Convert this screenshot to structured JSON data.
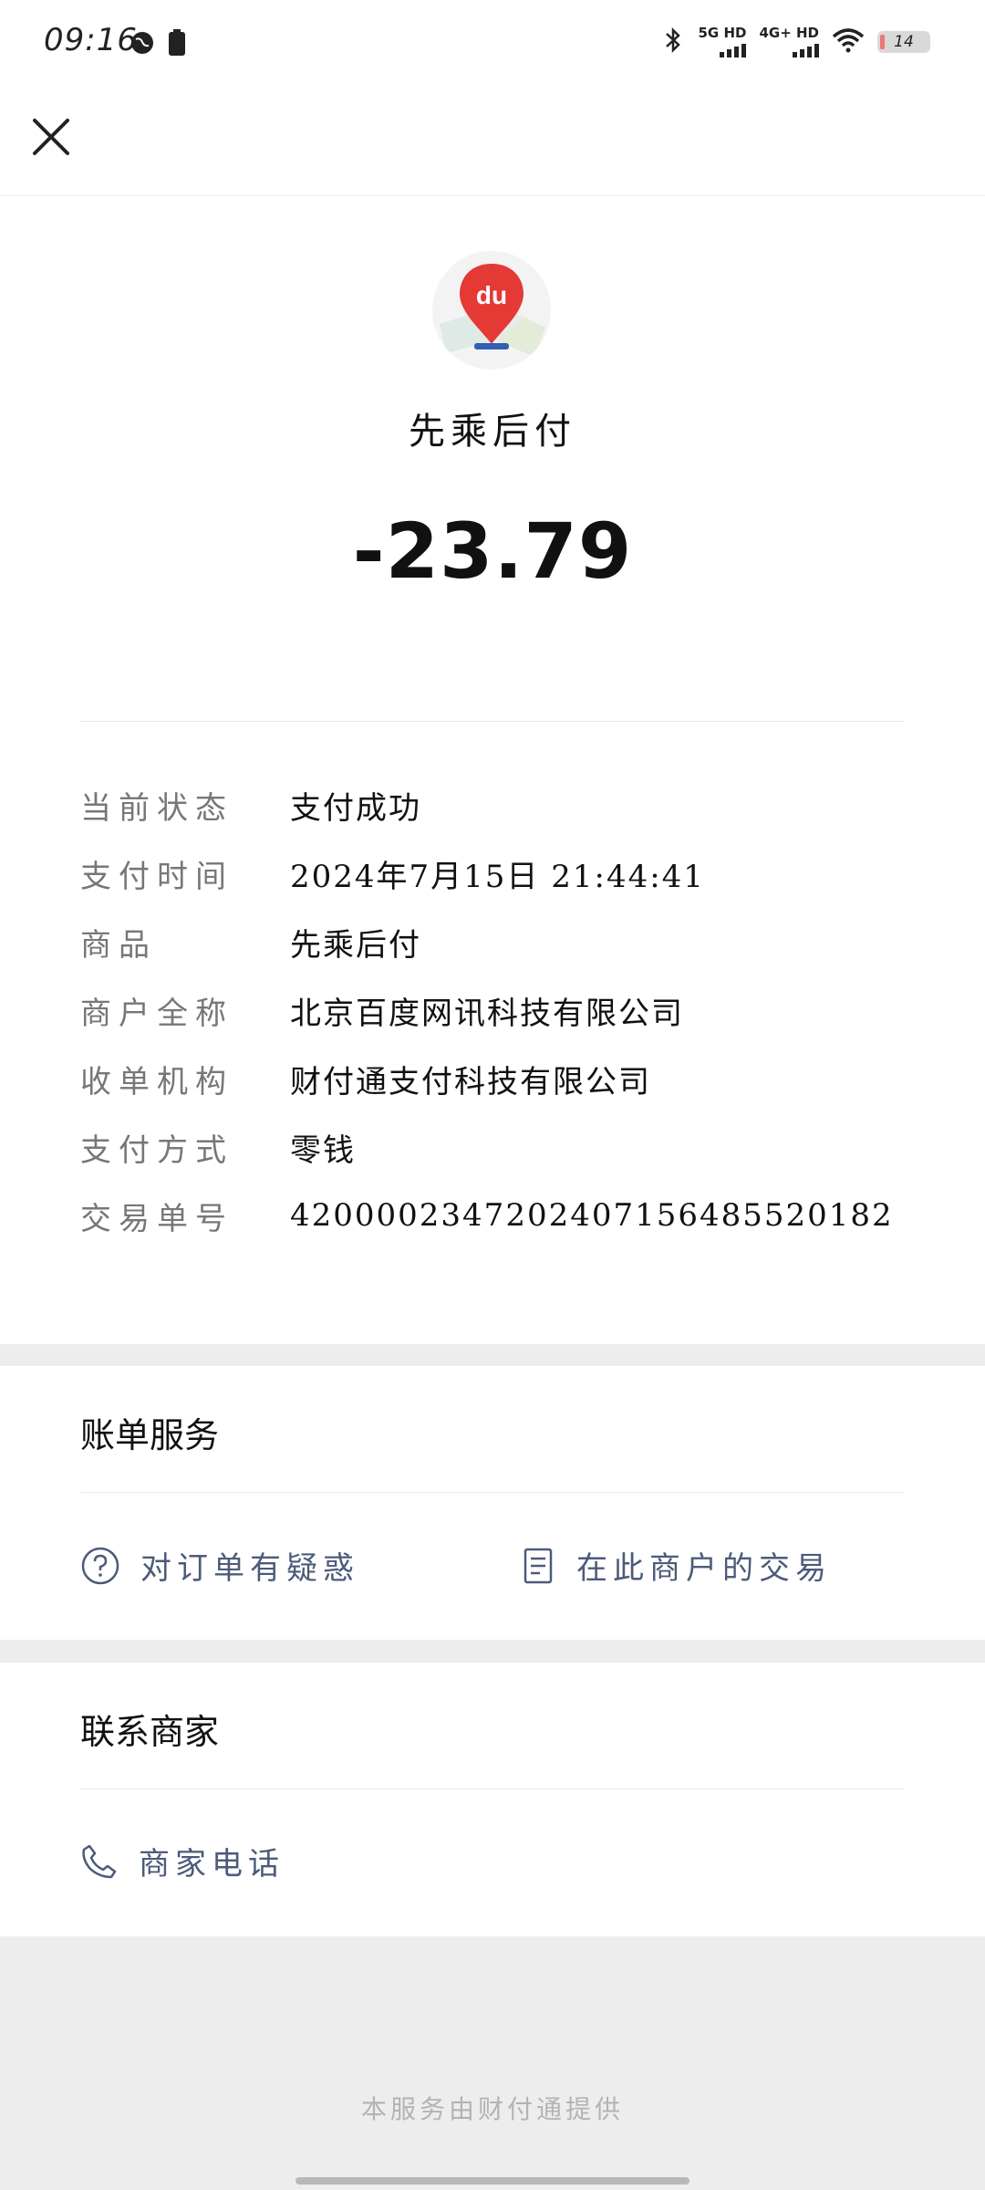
{
  "status_bar": {
    "time": "09:16",
    "network1": "5G HD",
    "network2": "4G+ HD",
    "battery": "14"
  },
  "merchant": {
    "logo_text": "du",
    "name": "先乘后付",
    "amount": "-23.79"
  },
  "details": [
    {
      "label": "当前状态",
      "value": "支付成功"
    },
    {
      "label": "支付时间",
      "value": "2024年7月15日 21:44:41"
    },
    {
      "label": "商品",
      "value": "先乘后付"
    },
    {
      "label": "商户全称",
      "value": "北京百度网讯科技有限公司"
    },
    {
      "label": "收单机构",
      "value": "财付通支付科技有限公司"
    },
    {
      "label": "支付方式",
      "value": "零钱"
    },
    {
      "label": "交易单号",
      "value": "4200002347202407156485520182"
    }
  ],
  "bill_service": {
    "title": "账单服务",
    "order_question": "对订单有疑惑",
    "merchant_transactions": "在此商户的交易"
  },
  "contact": {
    "title": "联系商家",
    "phone": "商家电话"
  },
  "footer": "本服务由财付通提供",
  "colors": {
    "link": "#4c5b7a",
    "background": "#ededed",
    "card": "#ffffff"
  }
}
